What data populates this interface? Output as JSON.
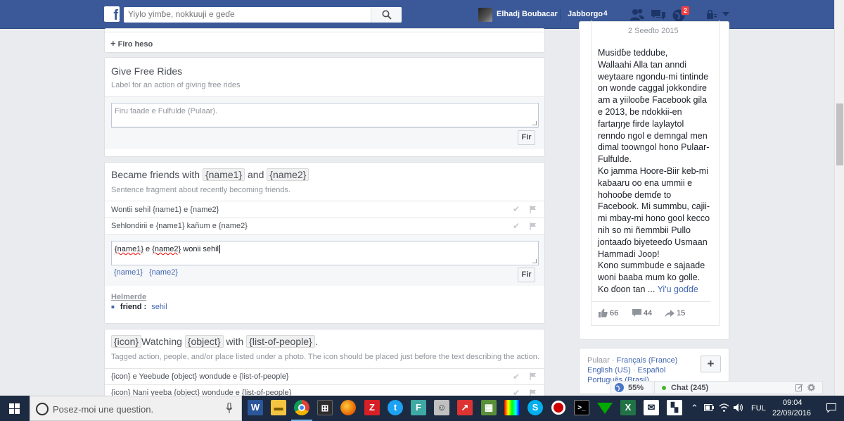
{
  "topbar": {
    "logo": "f",
    "search_placeholder": "Yiylo yimɓe, nokkuuji e geɗe",
    "user_name": "Elhadj Boubacar",
    "home_label": "Jabborgo",
    "home_count": "4",
    "notif_count": "2"
  },
  "top_card": {
    "add_label": "Firo heso"
  },
  "give_rides": {
    "title": "Give Free Rides",
    "desc": "Label for an action of giving free rides",
    "placeholder": "Firu faade e Fulfulde (Pulaar).",
    "button": "Fir"
  },
  "friends": {
    "title_prefix": "Became friends with",
    "tok1": "{name1}",
    "and": "and",
    "tok2": "{name2}",
    "desc": "Sentence fragment about recently becoming friends.",
    "rows": [
      "Wontii sehil {name1} e {name2}",
      "Sehlondirii e {name1} kañum e {name2}"
    ],
    "input_value_1": "{name1}",
    "input_value_2": " e ",
    "input_value_3": "{name2}",
    "input_value_4": " wonii sehil",
    "tags": [
      "{name1}",
      "{name2}"
    ],
    "button": "Fir",
    "helper_title": "Helmerde",
    "helper_key": "friend :",
    "helper_value": "sehil"
  },
  "watching": {
    "tok_icon": "{icon}",
    "word1": "Watching",
    "tok_object": "{object}",
    "word2": "with",
    "tok_people": "{list-of-people}",
    "dot": ".",
    "desc": "Tagged action, people, and/or place listed under a photo. The icon should be placed just before the text describing the action.",
    "rows": [
      "{icon} e Yeebude {object} wondude e {list-of-people}",
      "{icon} Nani yeeba {object} wondude e {list-of-people}"
    ]
  },
  "post": {
    "date": "2 Seeɗto 2015",
    "lines": [
      "Musidɓe teddube,",
      "Wallaahi Alla tan anndi",
      "weytaare ngondu-mi tintinde",
      "on wonde caggal jokkondire",
      "am a yiilooɓe Facebook gila",
      "e 2013, be ndokkii-en",
      "fartaŋŋe firde laylaytol",
      "renndo ngol e demngal men",
      "dimal toowngol hono Pulaar-",
      "Fulfulde.",
      "Ko jamma Hoore-Biir keb-mi",
      "kabaaru oo ena ummii e",
      "hohooɓe demɗe to",
      "Facebook. Mi summbu, cajii-",
      "mi mbay-mi hono gool kecco",
      "nih so mi ñemmbii Pullo",
      "jontaaɗo biyeteeɗo Usmaan",
      "Hammadi Joop!",
      "Kono summbude e sajaade",
      "woni baaba mum ko golle."
    ],
    "last_line": "Ko ɗoon tan ...",
    "see_more": "Yi'u goɗɗe",
    "likes": "66",
    "comments": "44",
    "shares": "15"
  },
  "languages": {
    "current": "Pulaar",
    "links": [
      "Français (France)",
      "English (US)",
      "Español",
      "Português (Brasil)"
    ],
    "plus": "+"
  },
  "zoom": "55%",
  "chat": "Chat (245)",
  "taskbar": {
    "search_placeholder": "Posez-moi une question.",
    "lang": "FUL",
    "time": "09:04",
    "date": "22/09/2016"
  }
}
